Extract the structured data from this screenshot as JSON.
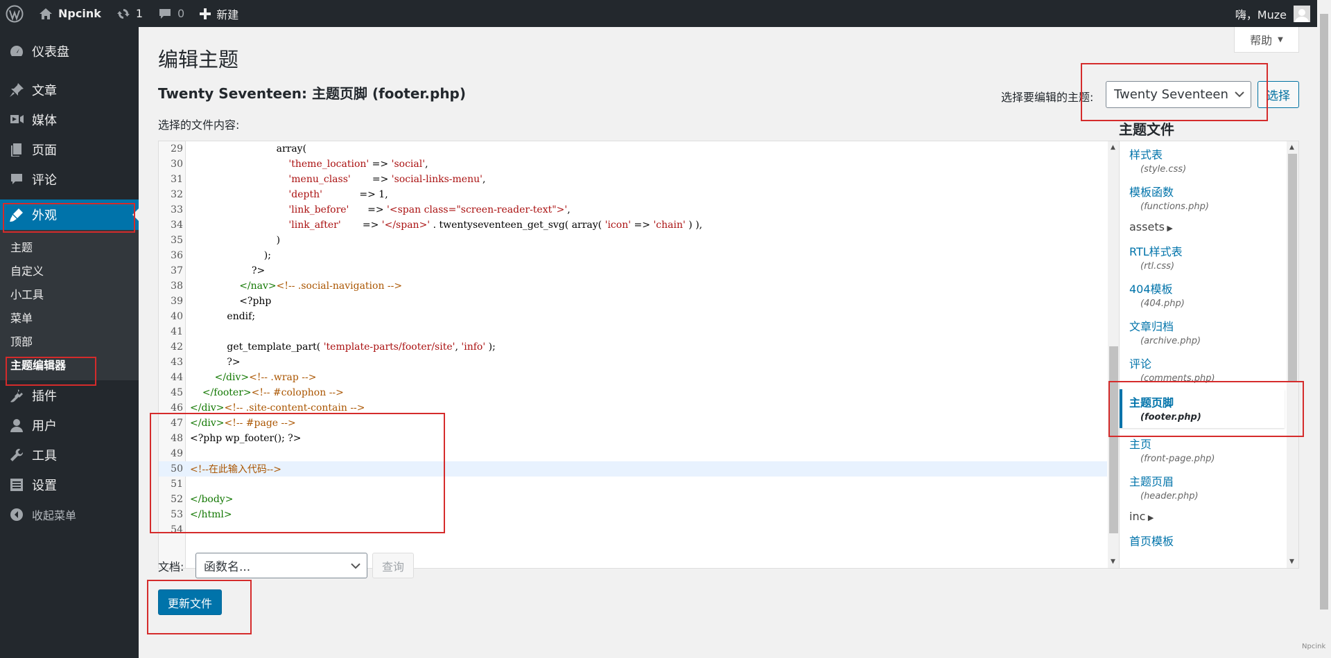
{
  "adminbar": {
    "site_name": "Npcink",
    "updates_count": "1",
    "comments_count": "0",
    "new_label": "新建",
    "greeting": "嗨，Muze"
  },
  "sidebar": {
    "items": [
      {
        "label": "仪表盘",
        "icon": "dashboard-icon"
      },
      {
        "label": "文章",
        "icon": "pin-icon"
      },
      {
        "label": "媒体",
        "icon": "media-icon"
      },
      {
        "label": "页面",
        "icon": "page-icon"
      },
      {
        "label": "评论",
        "icon": "comment-icon"
      },
      {
        "label": "外观",
        "icon": "appearance-icon"
      }
    ],
    "submenu": [
      "主题",
      "自定义",
      "小工具",
      "菜单",
      "顶部",
      "主题编辑器"
    ],
    "items_after": [
      {
        "label": "插件",
        "icon": "plugin-icon"
      },
      {
        "label": "用户",
        "icon": "user-icon"
      },
      {
        "label": "工具",
        "icon": "tools-icon"
      },
      {
        "label": "设置",
        "icon": "settings-icon"
      }
    ],
    "collapse_label": "收起菜单"
  },
  "main": {
    "help_label": "帮助",
    "page_title": "编辑主题",
    "file_title_theme": "Twenty Seventeen: ",
    "file_title_name": "主题页脚",
    "file_title_file": " (footer.php)",
    "theme_select_label": "选择要编辑的主题:",
    "theme_select_value": "Twenty Seventeen",
    "select_button": "选择",
    "content_label": "选择的文件内容:",
    "doc_label": "文档:",
    "doc_select_value": "函数名...",
    "lookup_button": "查询",
    "update_button": "更新文件"
  },
  "editor": {
    "lines": [
      {
        "n": "29",
        "parts": [
          {
            "t": "                            array("
          }
        ]
      },
      {
        "n": "30",
        "parts": [
          {
            "t": "                                "
          },
          {
            "t": "'theme_location'",
            "c": "str"
          },
          {
            "t": " => "
          },
          {
            "t": "'social'",
            "c": "str"
          },
          {
            "t": ","
          }
        ]
      },
      {
        "n": "31",
        "parts": [
          {
            "t": "                                "
          },
          {
            "t": "'menu_class'",
            "c": "str"
          },
          {
            "t": "       => "
          },
          {
            "t": "'social-links-menu'",
            "c": "str"
          },
          {
            "t": ","
          }
        ]
      },
      {
        "n": "32",
        "parts": [
          {
            "t": "                                "
          },
          {
            "t": "'depth'",
            "c": "str"
          },
          {
            "t": "            => 1,"
          }
        ]
      },
      {
        "n": "33",
        "parts": [
          {
            "t": "                                "
          },
          {
            "t": "'link_before'",
            "c": "str"
          },
          {
            "t": "      => "
          },
          {
            "t": "'<span class=\"screen-reader-text\">'",
            "c": "str"
          },
          {
            "t": ","
          }
        ]
      },
      {
        "n": "34",
        "parts": [
          {
            "t": "                                "
          },
          {
            "t": "'link_after'",
            "c": "str"
          },
          {
            "t": "       => "
          },
          {
            "t": "'</span>'",
            "c": "str"
          },
          {
            "t": " . twentyseventeen_get_svg( array( "
          },
          {
            "t": "'icon'",
            "c": "str"
          },
          {
            "t": " => "
          },
          {
            "t": "'chain'",
            "c": "str"
          },
          {
            "t": " ) ),"
          }
        ]
      },
      {
        "n": "35",
        "parts": [
          {
            "t": "                            )"
          }
        ]
      },
      {
        "n": "36",
        "parts": [
          {
            "t": "                        );"
          }
        ]
      },
      {
        "n": "37",
        "parts": [
          {
            "t": "                    ?>"
          }
        ]
      },
      {
        "n": "38",
        "parts": [
          {
            "t": "                "
          },
          {
            "t": "</nav>",
            "c": "tag"
          },
          {
            "t": "<!-- .social-navigation -->",
            "c": "com"
          }
        ]
      },
      {
        "n": "39",
        "parts": [
          {
            "t": "                <?php"
          }
        ]
      },
      {
        "n": "40",
        "parts": [
          {
            "t": "            endif;"
          }
        ]
      },
      {
        "n": "41",
        "parts": [
          {
            "t": ""
          }
        ]
      },
      {
        "n": "42",
        "parts": [
          {
            "t": "            get_template_part( "
          },
          {
            "t": "'template-parts/footer/site'",
            "c": "str"
          },
          {
            "t": ", "
          },
          {
            "t": "'info'",
            "c": "str"
          },
          {
            "t": " );"
          }
        ]
      },
      {
        "n": "43",
        "parts": [
          {
            "t": "            ?>"
          }
        ]
      },
      {
        "n": "44",
        "parts": [
          {
            "t": "        "
          },
          {
            "t": "</div>",
            "c": "tag"
          },
          {
            "t": "<!-- .wrap -->",
            "c": "com"
          }
        ]
      },
      {
        "n": "45",
        "parts": [
          {
            "t": "    "
          },
          {
            "t": "</footer>",
            "c": "tag"
          },
          {
            "t": "<!-- #colophon -->",
            "c": "com"
          }
        ]
      },
      {
        "n": "46",
        "parts": [
          {
            "t": "</div>",
            "c": "tag"
          },
          {
            "t": "<!-- .site-content-contain -->",
            "c": "com"
          }
        ]
      },
      {
        "n": "47",
        "parts": [
          {
            "t": "</div>",
            "c": "tag"
          },
          {
            "t": "<!-- #page -->",
            "c": "com"
          }
        ]
      },
      {
        "n": "48",
        "parts": [
          {
            "t": "<?php wp_footer(); ?>"
          }
        ]
      },
      {
        "n": "49",
        "parts": [
          {
            "t": ""
          }
        ]
      },
      {
        "n": "50",
        "parts": [
          {
            "t": "<!--在此输入代码-->",
            "c": "com"
          }
        ],
        "active": true
      },
      {
        "n": "51",
        "parts": [
          {
            "t": ""
          }
        ]
      },
      {
        "n": "52",
        "parts": [
          {
            "t": "</body>",
            "c": "tag"
          }
        ]
      },
      {
        "n": "53",
        "parts": [
          {
            "t": "</html>",
            "c": "tag"
          }
        ]
      },
      {
        "n": "54",
        "parts": [
          {
            "t": ""
          }
        ]
      }
    ]
  },
  "theme_files": {
    "title": "主题文件",
    "items": [
      {
        "name": "样式表",
        "file": "(style.css)"
      },
      {
        "name": "模板函数",
        "file": "(functions.php)"
      },
      {
        "folder": "assets"
      },
      {
        "name": "RTL样式表",
        "file": "(rtl.css)"
      },
      {
        "name": "404模板",
        "file": "(404.php)"
      },
      {
        "name": "文章归档",
        "file": "(archive.php)"
      },
      {
        "name": "评论",
        "file": "(comments.php)"
      },
      {
        "name": "主题页脚",
        "file": "(footer.php)",
        "current": true
      },
      {
        "name": "主页",
        "file": "(front-page.php)"
      },
      {
        "name": "主题页眉",
        "file": "(header.php)"
      },
      {
        "folder": "inc"
      },
      {
        "name": "首页模板",
        "file": ""
      }
    ]
  },
  "footer_brand": "Npcink",
  "colors": {
    "adminbar": "#23282d",
    "accent": "#0073aa",
    "annotation_red": "#d52b2b"
  }
}
